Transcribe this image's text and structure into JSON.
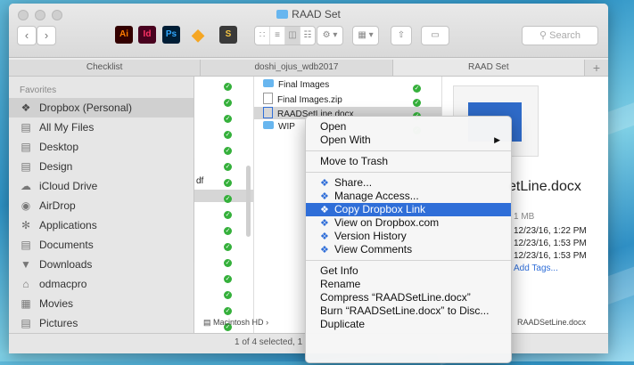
{
  "window": {
    "title": "RAAD Set"
  },
  "toolbar": {
    "search_placeholder": "Search",
    "back": "‹",
    "forward": "›",
    "apps": [
      {
        "label": "Ai",
        "color": "#ff7c00",
        "bg": "#330000"
      },
      {
        "label": "Id",
        "color": "#ff3366",
        "bg": "#49021f"
      },
      {
        "label": "Ps",
        "color": "#31a8ff",
        "bg": "#001e36"
      }
    ]
  },
  "tabs": [
    "Checklist",
    "doshi_ojus_wdb2017",
    "RAAD Set",
    "+"
  ],
  "sidebar": {
    "heading": "Favorites",
    "items": [
      "Dropbox (Personal)",
      "All My Files",
      "Desktop",
      "Design",
      "iCloud Drive",
      "AirDrop",
      "Applications",
      "Documents",
      "Downloads",
      "odmacpro",
      "Movies",
      "Pictures"
    ],
    "selected_index": 0
  },
  "column2": {
    "files": [
      "Final Images",
      "Final Images.zip",
      "RAADSetLine.docx",
      "WIP"
    ],
    "partial_text": "df"
  },
  "preview": {
    "file_name": "etLine.docx",
    "size": "1 MB",
    "dates": [
      "12/23/16, 1:22 PM",
      "12/23/16, 1:53 PM",
      "12/23/16, 1:53 PM"
    ],
    "add_tags": "Add Tags..."
  },
  "context_menu": {
    "items": [
      {
        "label": "Open",
        "submenu": false,
        "dropbox": false
      },
      {
        "label": "Open With",
        "submenu": true,
        "dropbox": false
      },
      {
        "sep": true
      },
      {
        "label": "Move to Trash",
        "submenu": false,
        "dropbox": false
      },
      {
        "sep": true
      },
      {
        "label": "Share...",
        "submenu": false,
        "dropbox": true
      },
      {
        "label": "Manage Access...",
        "submenu": false,
        "dropbox": true
      },
      {
        "label": "Copy Dropbox Link",
        "submenu": false,
        "dropbox": true,
        "highlighted": true
      },
      {
        "label": "View on Dropbox.com",
        "submenu": false,
        "dropbox": true
      },
      {
        "label": "Version History",
        "submenu": false,
        "dropbox": true
      },
      {
        "label": "View Comments",
        "submenu": false,
        "dropbox": true
      },
      {
        "sep": true
      },
      {
        "label": "Get Info",
        "submenu": false,
        "dropbox": false
      },
      {
        "label": "Rename",
        "submenu": false,
        "dropbox": false
      },
      {
        "label": "Compress “RAADSetLine.docx”",
        "submenu": false,
        "dropbox": false
      },
      {
        "label": "Burn “RAADSetLine.docx” to Disc...",
        "submenu": false,
        "dropbox": false
      },
      {
        "label": "Duplicate",
        "submenu": false,
        "dropbox": false
      }
    ]
  },
  "pathbar": {
    "disk": "Macintosh HD",
    "separator": "›",
    "end_file": "RAADSetLine.docx"
  },
  "status": {
    "text": "1 of 4 selected, 1"
  },
  "colors": {
    "accent": "#2f6ed8",
    "check": "#35b03b",
    "folder": "#68b6ef"
  }
}
